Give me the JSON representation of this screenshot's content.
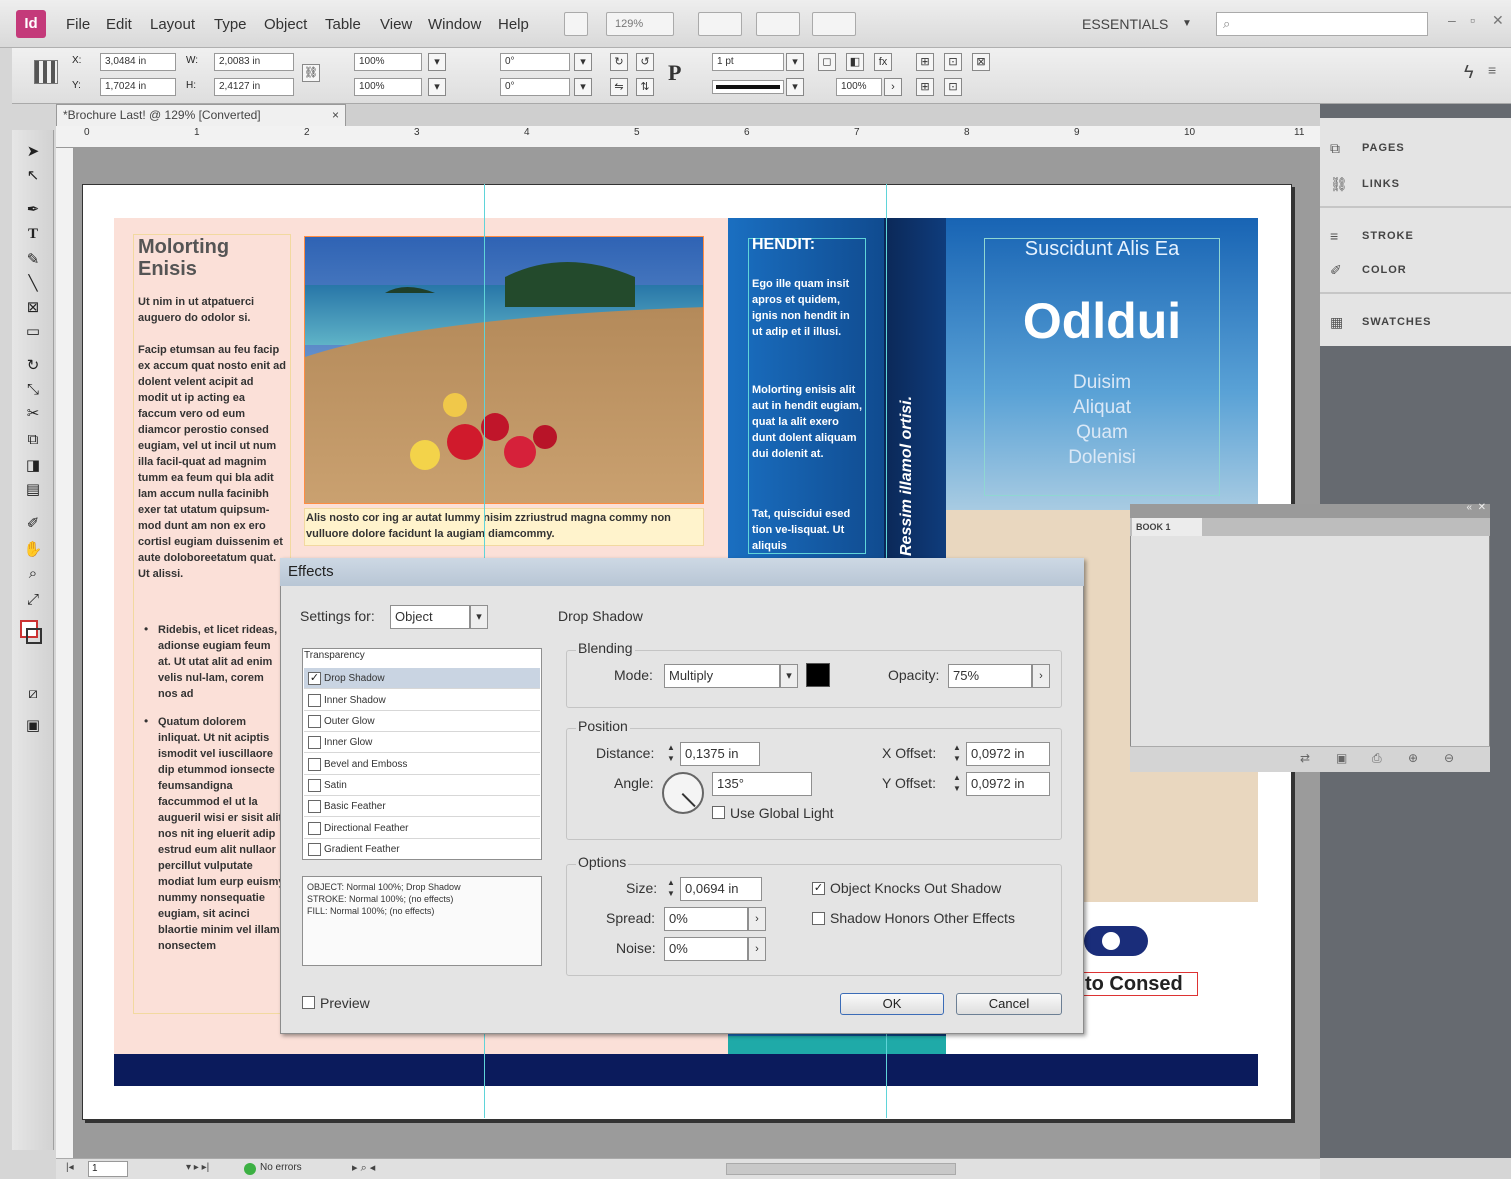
{
  "app": {
    "logo": "Id",
    "menu": [
      "File",
      "Edit",
      "Layout",
      "Type",
      "Object",
      "Table",
      "View",
      "Window",
      "Help"
    ],
    "zoom": "129%",
    "workspace": "ESSENTIALS",
    "search_placeholder": "",
    "accent_color": "#c43a7a"
  },
  "control": {
    "x": "3,0484 in",
    "y": "1,7024 in",
    "w": "2,0083 in",
    "h": "2,4127 in",
    "scale_x": "100%",
    "scale_y": "100%",
    "rotate": "0°",
    "shear": "0°",
    "stroke_weight": "1 pt",
    "opacity": "100%"
  },
  "document": {
    "tab_title": "*Brochure Last! @ 129% [Converted]"
  },
  "ruler": {
    "labels": [
      "0",
      "1",
      "2",
      "3",
      "4",
      "5",
      "6",
      "7",
      "8",
      "9",
      "10",
      "11"
    ]
  },
  "brochure": {
    "heading": "Molorting\nEnisis",
    "intro": "Ut nim in ut atpatuerci auguero do odolor si.",
    "body": "Facip etumsan au feu facip ex accum quat nosto enit ad dolent velent acipit ad modit ut ip acting ea faccum vero od eum diamcor perostio consed eugiam, vel ut incil ut num illa facil-quat ad magnim tumm ea feum qui bla adit lam accum nulla facinibh exer tat utatum quipsum-mod dunt am non ex ero cortisl eugiam duissenim et aute doloboreetatum quat. Ut alissi.",
    "bullet1": "Ridebis, et licet rideas, adionse eugiam feum at. Ut utat alit ad enim velis nul-lam, corem nos ad",
    "bullet2": "Quatum dolorem inliquat. Ut nit aciptis ismodit vel iuscillaore dip etummod ionsecte feumsandigna faccummod el ut la augueril wisi er sisit alit nos nit ing eluerit adip estrud eum alit nullaor percillut vulputate modiat lum eurp euismy nummy nonsequatie eugiam, sit acinci blaortie minim vel illam nonsectem",
    "caption": "Alis nosto cor ing ar autat lummy nisim zzriustrud magna commy non vulluore dolore facidunt la augiam diamcommy.",
    "panel2_heading": "HENDIT:",
    "panel2_p1": "Ego ille quam insit apros et quidem, ignis non hendit in ut adip et il illusi.",
    "panel2_p2": "Molorting enisis alit aut in hendit eugiam, quat la alit exero dunt dolent aliquam dui dolenit at.",
    "panel2_p3": "Tat, quiscidui esed tion ve-lisquat. Ut aliquis",
    "vertical_text": "Ressim illamol ortisi.",
    "panel3_title": "Suscidunt Alis Ea",
    "panel3_big": "Odldui",
    "panel3_lines": [
      "Duisim",
      "Aliquat",
      "Quam",
      "Dolenisi"
    ],
    "consed": "to Consed"
  },
  "dock": {
    "items": [
      "PAGES",
      "LINKS",
      "STROKE",
      "COLOR",
      "SWATCHES"
    ]
  },
  "book_panel": {
    "tab": "BOOK 1"
  },
  "effects": {
    "title": "Effects",
    "settings_for_label": "Settings for:",
    "settings_for_value": "Object",
    "section_title": "Drop Shadow",
    "list_header": "Transparency",
    "list_items": [
      "Drop Shadow",
      "Inner Shadow",
      "Outer Glow",
      "Inner Glow",
      "Bevel and Emboss",
      "Satin",
      "Basic Feather",
      "Directional Feather",
      "Gradient Feather"
    ],
    "list_checked": [
      true,
      false,
      false,
      false,
      false,
      false,
      false,
      false,
      false
    ],
    "summary": "OBJECT: Normal 100%; Drop Shadow\nSTROKE: Normal 100%; (no effects)\nFILL: Normal 100%; (no effects)",
    "blending_label": "Blending",
    "mode_label": "Mode:",
    "mode_value": "Multiply",
    "shadow_color": "#000000",
    "opacity_label": "Opacity:",
    "opacity_value": "75%",
    "position_label": "Position",
    "distance_label": "Distance:",
    "distance_value": "0,1375 in",
    "angle_label": "Angle:",
    "angle_value": "135°",
    "global_light_label": "Use Global Light",
    "x_offset_label": "X Offset:",
    "x_offset_value": "0,0972 in",
    "y_offset_label": "Y Offset:",
    "y_offset_value": "0,0972 in",
    "options_label": "Options",
    "size_label": "Size:",
    "size_value": "0,0694 in",
    "spread_label": "Spread:",
    "spread_value": "0%",
    "noise_label": "Noise:",
    "noise_value": "0%",
    "knocks_out_label": "Object Knocks Out Shadow",
    "honors_label": "Shadow Honors Other Effects",
    "preview_label": "Preview",
    "ok_label": "OK",
    "cancel_label": "Cancel"
  },
  "status": {
    "page": "1",
    "errors": "No errors"
  }
}
